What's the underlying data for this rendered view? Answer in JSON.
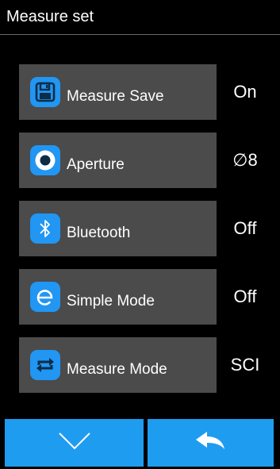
{
  "header": {
    "title": "Measure set"
  },
  "settings": [
    {
      "label": "Measure Save",
      "value": "On",
      "icon": "save-icon"
    },
    {
      "label": "Aperture",
      "value": "∅8",
      "icon": "aperture-icon"
    },
    {
      "label": "Bluetooth",
      "value": "Off",
      "icon": "bluetooth-icon"
    },
    {
      "label": "Simple Mode",
      "value": "Off",
      "icon": "simple-mode-icon"
    },
    {
      "label": "Measure Mode",
      "value": "SCI",
      "icon": "repeat-icon"
    }
  ],
  "footer": {
    "left_icon": "chevron-down-icon",
    "right_icon": "back-arrow-icon"
  },
  "colors": {
    "accent": "#2196f3",
    "row_bg": "#4b4b4b",
    "background": "#000000"
  }
}
